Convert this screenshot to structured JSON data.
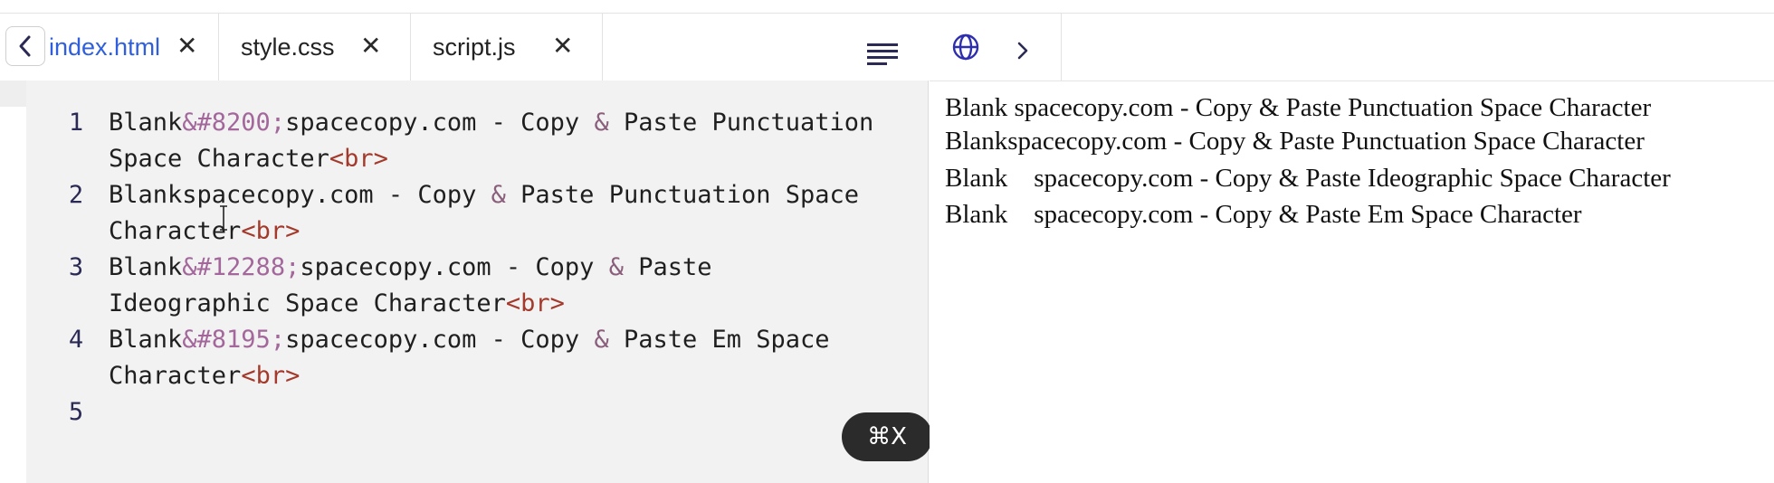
{
  "tabs": [
    {
      "label": "index.html",
      "active": true
    },
    {
      "label": "style.css",
      "active": false
    },
    {
      "label": "script.js",
      "active": false
    }
  ],
  "icons": {
    "back": "chevron-left-icon",
    "close": "close-icon",
    "format": "align-lines-icon",
    "globe": "globe-icon",
    "chevron": "chevron-right-icon"
  },
  "editor": {
    "lines": [
      {
        "num": "1",
        "row1": {
          "a": "Blank",
          "ent": "&#8200;",
          "b": "spacecopy.com - Copy ",
          "amp": "&",
          "c": " Paste Punctuation"
        },
        "row2": {
          "a": "Space Character",
          "tag": "<br>"
        }
      },
      {
        "num": "2",
        "row1": {
          "a": "Blankspacecopy.com - Copy ",
          "amp": "&",
          "c": " Paste Punctuation Space"
        },
        "row2": {
          "a": "Character",
          "tag": "<br>"
        }
      },
      {
        "num": "3",
        "row1": {
          "a": "Blank",
          "ent": "&#12288;",
          "b": "spacecopy.com - Copy ",
          "amp": "&",
          "c": " Paste"
        },
        "row2": {
          "a": "Ideographic Space Character",
          "tag": "<br>"
        }
      },
      {
        "num": "4",
        "row1": {
          "a": "Blank",
          "ent": "&#8195;",
          "b": "spacecopy.com - Copy ",
          "amp": "&",
          "c": " Paste Em Space"
        },
        "row2": {
          "a": "Character",
          "tag": "<br>"
        }
      },
      {
        "num": "5"
      }
    ]
  },
  "shortcut": "⌘X",
  "preview": {
    "lines": [
      "Blank spacecopy.com - Copy & Paste Punctuation Space Character",
      "Blankspacecopy.com - Copy & Paste Punctuation Space Character",
      "Blank    spacecopy.com - Copy & Paste Ideographic Space Character",
      "Blank    spacecopy.com - Copy & Paste Em Space Character"
    ]
  }
}
